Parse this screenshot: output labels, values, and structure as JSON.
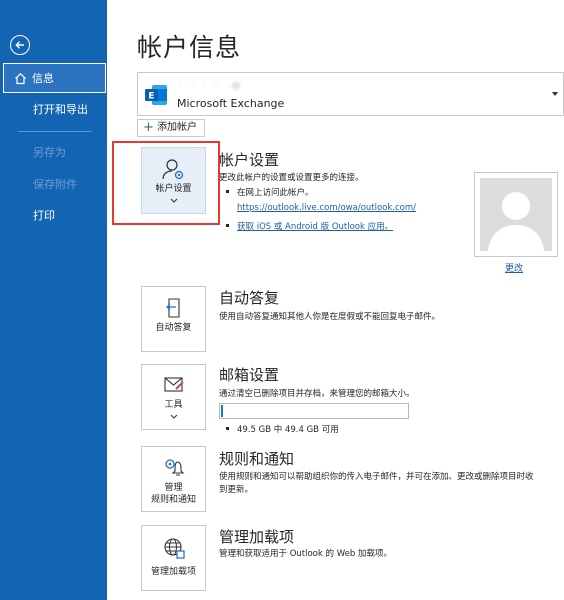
{
  "sidebar": {
    "back_icon": "back-arrow-icon",
    "items": [
      {
        "label": "信息",
        "state": "active"
      },
      {
        "label": "打开和导出",
        "state": "normal"
      },
      {
        "label": "另存为",
        "state": "disabled"
      },
      {
        "label": "保存附件",
        "state": "disabled"
      },
      {
        "label": "打印",
        "state": "normal"
      }
    ],
    "bg_color": "#1464b4"
  },
  "main": {
    "title": "帐户信息",
    "account": {
      "email_blurred": "·  ·· ·  ·· ·@",
      "type": "Microsoft Exchange"
    },
    "add_account_label": "添加帐户",
    "account_settings": {
      "card_label": "帐户设置",
      "title": "帐户设置",
      "desc": "更改此帐户的设置或设置更多的连接。",
      "bullet1": "在网上访问此帐户。",
      "link1": "https://outlook.live.com/owa/outlook.com/",
      "link2": "获取 iOS 或 Android 版 Outlook 应用。"
    },
    "profile": {
      "change_label": "更改"
    },
    "auto_reply": {
      "card_label": "自动答复",
      "title": "自动答复",
      "desc": "使用自动答复通知其他人你是在度假或不能回复电子邮件。"
    },
    "mailbox": {
      "card_label": "工具",
      "title": "邮箱设置",
      "desc": "通过清空已删除项目并存档，来管理您的邮箱大小。",
      "used_fraction": 0.012,
      "usage_text": "49.5 GB 中 49.4 GB 可用"
    },
    "rules": {
      "card_label_1": "管理",
      "card_label_2": "规则和通知",
      "title": "规则和通知",
      "desc_1": "使用规则和通知可以帮助组织你的传入电子邮件，并可在添加、更改或删除项目时收",
      "desc_2": "到更新。"
    },
    "addins": {
      "card_label": "管理加载项",
      "title": "管理加载项",
      "desc": "管理和获取适用于 Outlook 的 Web 加载项。"
    }
  },
  "colors": {
    "accent": "#1464b4",
    "link": "#1e5fa8",
    "highlight": "#e53935"
  }
}
